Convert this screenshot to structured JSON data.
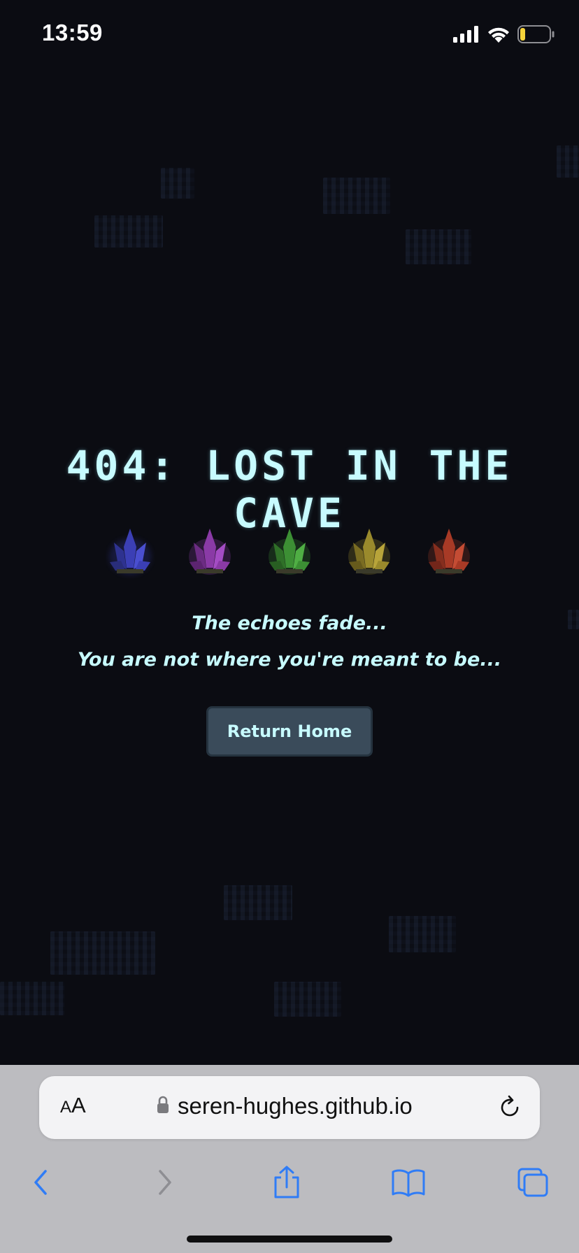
{
  "status_bar": {
    "time": "13:59",
    "signal_icon": "cellular-signal-icon",
    "wifi_icon": "wifi-icon",
    "battery_icon": "battery-low-icon",
    "battery_color": "#f5d33a"
  },
  "page": {
    "title": "404: LOST IN THE CAVE",
    "message_line1": "The echoes fade...",
    "message_line2": "You are not where you're meant to be...",
    "button_label": "Return Home",
    "text_color": "#c7fbff",
    "background_color": "#0b0c12",
    "crystals": [
      {
        "name": "blue-crystal-icon",
        "color": "#3b3fb5"
      },
      {
        "name": "purple-crystal-icon",
        "color": "#8a3aa6"
      },
      {
        "name": "green-crystal-icon",
        "color": "#3c8f34"
      },
      {
        "name": "yellow-crystal-icon",
        "color": "#9a8a2c"
      },
      {
        "name": "red-crystal-icon",
        "color": "#a83a26"
      }
    ]
  },
  "browser": {
    "text_size_button": {
      "small": "A",
      "big": "A"
    },
    "url": "seren-hughes.github.io",
    "lock_icon": "lock-icon",
    "reload_icon": "reload-icon",
    "toolbar": {
      "back": "back-chevron-icon",
      "forward": "forward-chevron-icon",
      "share": "share-icon",
      "bookmarks": "bookmarks-icon",
      "tabs": "tabs-icon"
    },
    "accent_color": "#2f7cf6"
  }
}
